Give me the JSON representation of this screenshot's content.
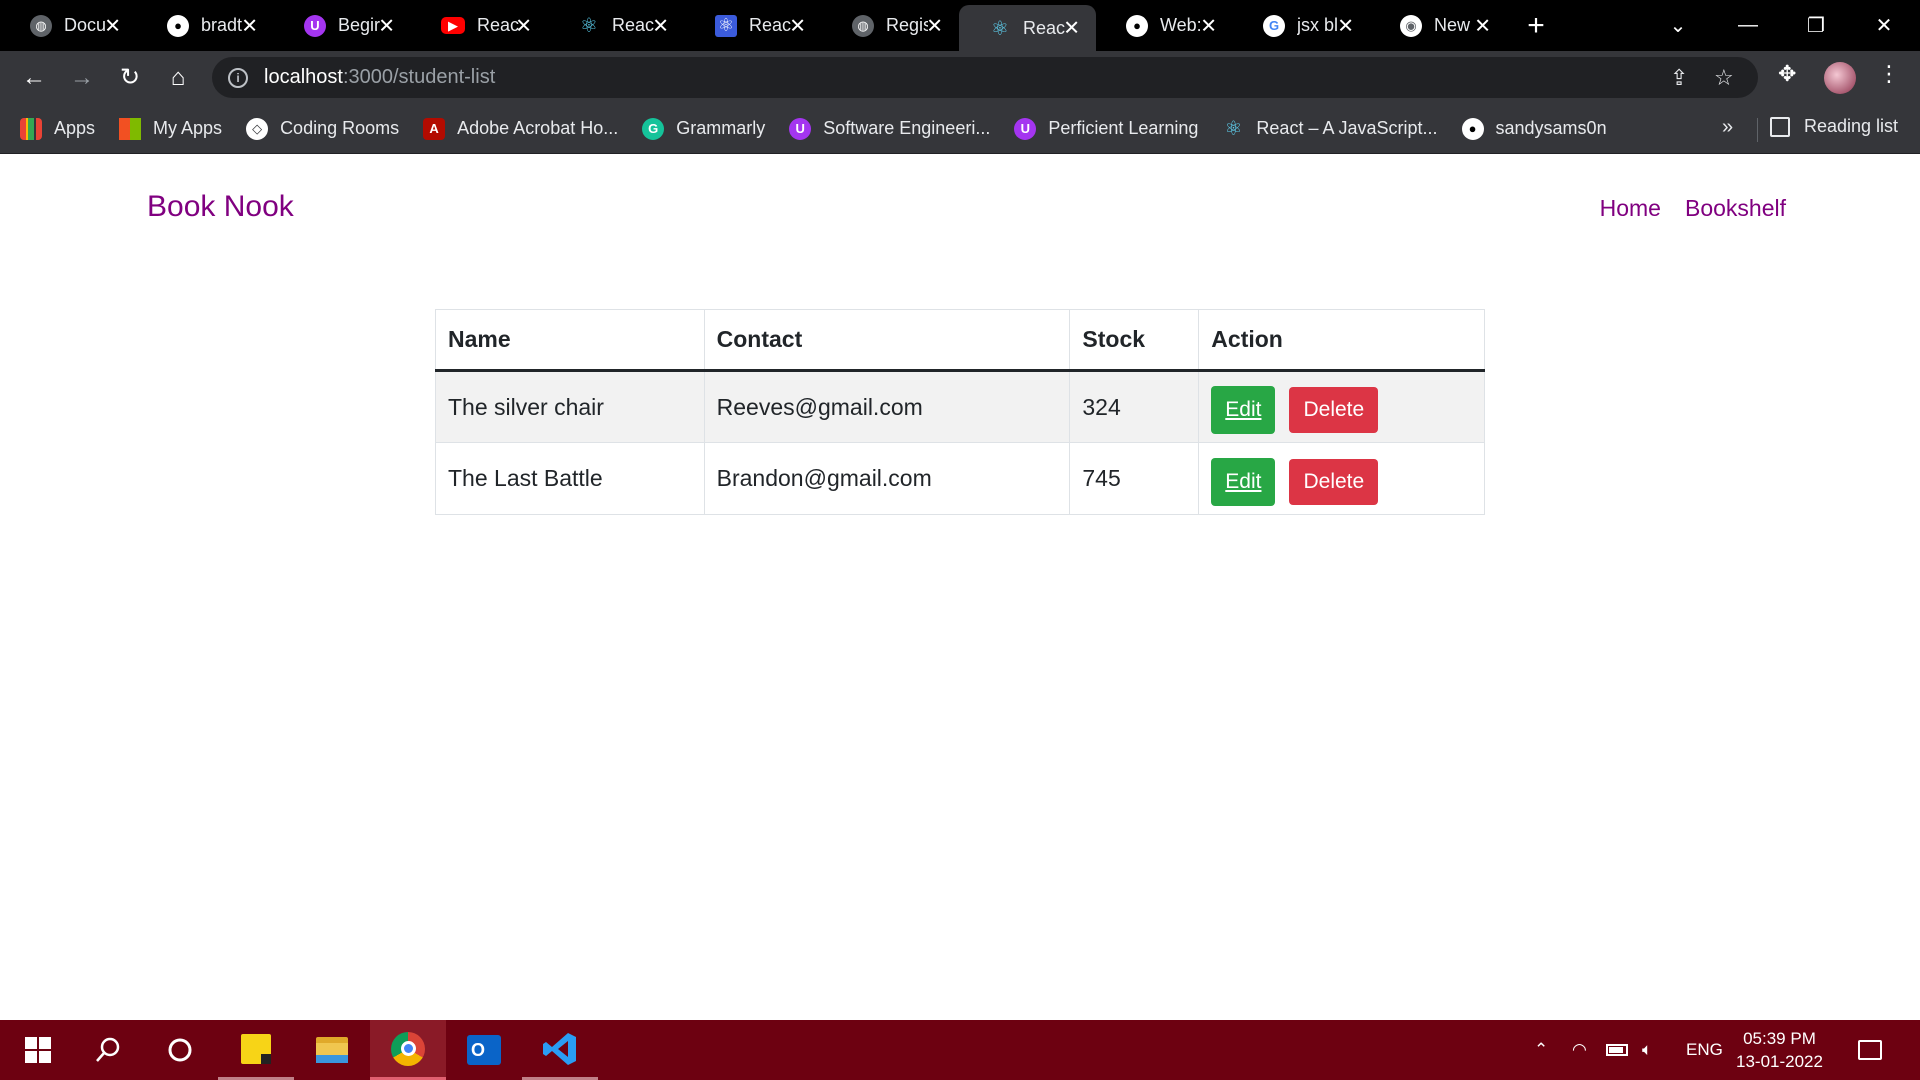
{
  "browser": {
    "tabs": [
      {
        "title": "Docu",
        "favicon": "globe-icon",
        "color": "#3c4043"
      },
      {
        "title": "bradt",
        "favicon": "github-icon",
        "color": "#ffffff"
      },
      {
        "title": "Begir",
        "favicon": "udemy-icon",
        "color": "#a435f0"
      },
      {
        "title": "React",
        "favicon": "youtube-icon",
        "color": "#ff0000"
      },
      {
        "title": "React",
        "favicon": "react-icon",
        "color": "#61dafb"
      },
      {
        "title": "React",
        "favicon": "react-icon",
        "color": "#61dafb"
      },
      {
        "title": "Regis",
        "favicon": "globe-icon",
        "color": "#3c4043"
      },
      {
        "title": "React",
        "favicon": "react-icon",
        "color": "#61dafb",
        "active": true
      },
      {
        "title": "Web:",
        "favicon": "github-icon",
        "color": "#ffffff"
      },
      {
        "title": "jsx bl",
        "favicon": "google-icon",
        "color": "#ffffff"
      },
      {
        "title": "New",
        "favicon": "chrome-icon",
        "color": "#ffffff"
      }
    ],
    "address": {
      "host": "localhost",
      "path": ":3000/student-list"
    },
    "bookmarks": [
      {
        "label": "Apps",
        "icon": "apps-grid-icon"
      },
      {
        "label": "My Apps",
        "icon": "microsoft-icon"
      },
      {
        "label": "Coding Rooms",
        "icon": "coding-rooms-icon"
      },
      {
        "label": "Adobe Acrobat Ho...",
        "icon": "acrobat-icon"
      },
      {
        "label": "Grammarly",
        "icon": "grammarly-icon"
      },
      {
        "label": "Software Engineeri...",
        "icon": "udemy-icon"
      },
      {
        "label": "Perficient Learning",
        "icon": "udemy-icon"
      },
      {
        "label": "React – A JavaScript...",
        "icon": "react-icon"
      },
      {
        "label": "sandysams0n",
        "icon": "github-icon"
      }
    ],
    "bookmarks_more": "»",
    "reading_list": "Reading list"
  },
  "page": {
    "brand": "Book Nook",
    "nav": {
      "home": "Home",
      "bookshelf": "Bookshelf"
    },
    "table": {
      "headers": [
        "Name",
        "Contact",
        "Stock",
        "Action"
      ],
      "rows": [
        {
          "name": "The silver chair",
          "contact": "Reeves@gmail.com",
          "stock": "324",
          "edit": "Edit",
          "delete": "Delete"
        },
        {
          "name": "The Last Battle",
          "contact": "Brandon@gmail.com",
          "stock": "745",
          "edit": "Edit",
          "delete": "Delete"
        }
      ]
    }
  },
  "taskbar": {
    "language": "ENG",
    "time": "05:39 PM",
    "date": "13-01-2022"
  },
  "colors": {
    "brand": "#800080",
    "edit_button": "#28a745",
    "delete_button": "#dc3545",
    "taskbar": "#6d0111"
  }
}
